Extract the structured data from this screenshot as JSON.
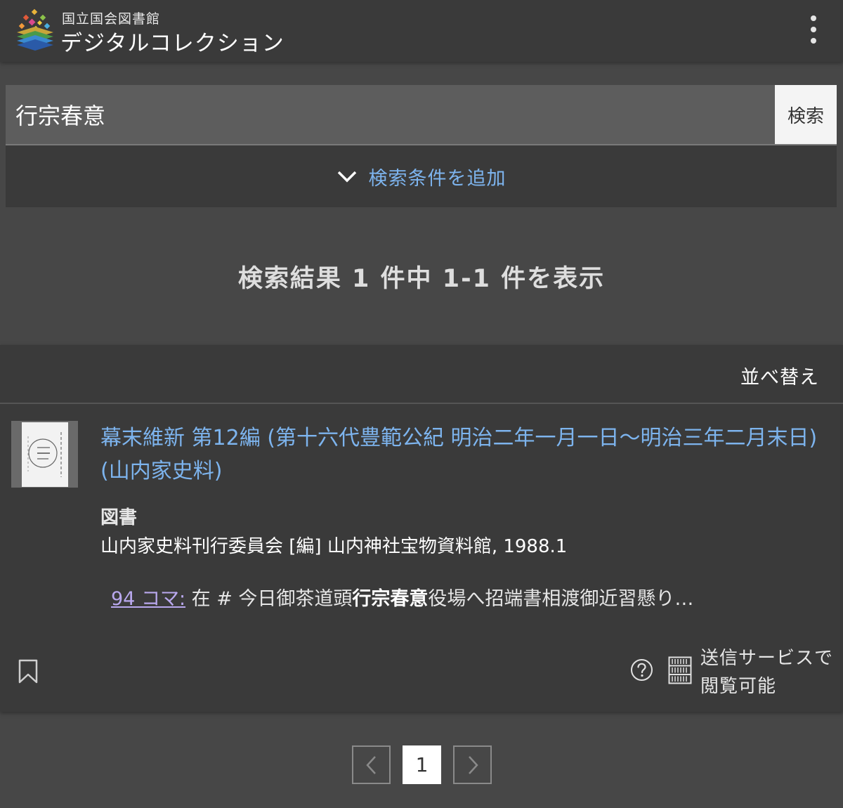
{
  "header": {
    "org_name": "国立国会図書館",
    "app_name": "デジタルコレクション"
  },
  "search": {
    "query": "行宗春意",
    "button_label": "検索",
    "add_condition_label": "検索条件を追加"
  },
  "results": {
    "summary": "検索結果 1 件中 1-1 件を表示",
    "sort_label": "並べ替え",
    "items": [
      {
        "title": "幕末維新 第12編 (第十六代豊範公紀 明治二年一月一日～明治三年二月末日) (山内家史料)",
        "type": "図書",
        "meta": "山内家史料刊行委員会 [編] 山内神社宝物資料館, 1988.1",
        "snippet_link": "94 コマ:",
        "snippet_before": " 在 # 今日御茶道頭",
        "snippet_highlight": "行宗春意",
        "snippet_after": "役場へ招端書相渡御近習懸り…",
        "service_label_line1": "送信サービスで",
        "service_label_line2": "閲覧可能"
      }
    ]
  },
  "pagination": {
    "current_page": "1"
  },
  "colors": {
    "background": "#474747",
    "panel": "#3a3a3a",
    "link": "#7db4ee",
    "visited_link": "#b9a8ee"
  }
}
